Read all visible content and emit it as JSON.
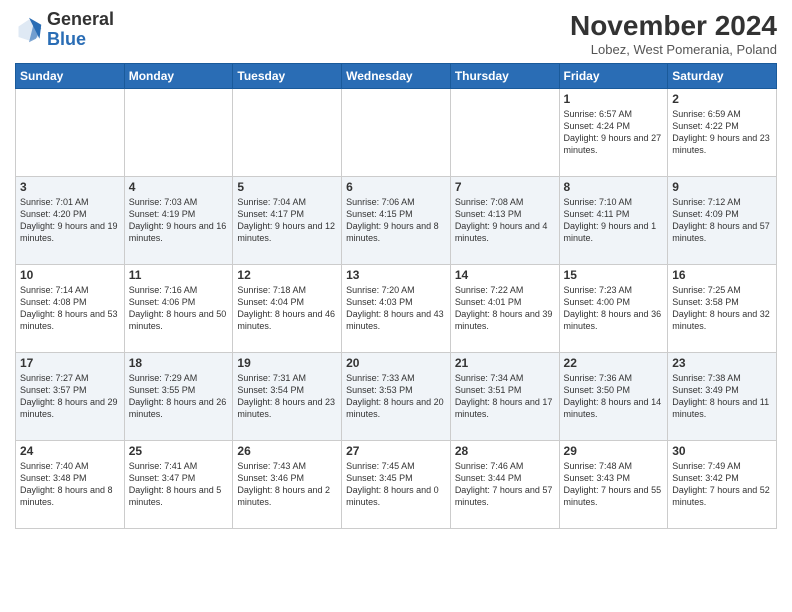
{
  "header": {
    "logo_general": "General",
    "logo_blue": "Blue",
    "month_title": "November 2024",
    "location": "Lobez, West Pomerania, Poland"
  },
  "weekdays": [
    "Sunday",
    "Monday",
    "Tuesday",
    "Wednesday",
    "Thursday",
    "Friday",
    "Saturday"
  ],
  "weeks": [
    [
      {
        "day": "",
        "info": ""
      },
      {
        "day": "",
        "info": ""
      },
      {
        "day": "",
        "info": ""
      },
      {
        "day": "",
        "info": ""
      },
      {
        "day": "",
        "info": ""
      },
      {
        "day": "1",
        "info": "Sunrise: 6:57 AM\nSunset: 4:24 PM\nDaylight: 9 hours\nand 27 minutes."
      },
      {
        "day": "2",
        "info": "Sunrise: 6:59 AM\nSunset: 4:22 PM\nDaylight: 9 hours\nand 23 minutes."
      }
    ],
    [
      {
        "day": "3",
        "info": "Sunrise: 7:01 AM\nSunset: 4:20 PM\nDaylight: 9 hours\nand 19 minutes."
      },
      {
        "day": "4",
        "info": "Sunrise: 7:03 AM\nSunset: 4:19 PM\nDaylight: 9 hours\nand 16 minutes."
      },
      {
        "day": "5",
        "info": "Sunrise: 7:04 AM\nSunset: 4:17 PM\nDaylight: 9 hours\nand 12 minutes."
      },
      {
        "day": "6",
        "info": "Sunrise: 7:06 AM\nSunset: 4:15 PM\nDaylight: 9 hours\nand 8 minutes."
      },
      {
        "day": "7",
        "info": "Sunrise: 7:08 AM\nSunset: 4:13 PM\nDaylight: 9 hours\nand 4 minutes."
      },
      {
        "day": "8",
        "info": "Sunrise: 7:10 AM\nSunset: 4:11 PM\nDaylight: 9 hours\nand 1 minute."
      },
      {
        "day": "9",
        "info": "Sunrise: 7:12 AM\nSunset: 4:09 PM\nDaylight: 8 hours\nand 57 minutes."
      }
    ],
    [
      {
        "day": "10",
        "info": "Sunrise: 7:14 AM\nSunset: 4:08 PM\nDaylight: 8 hours\nand 53 minutes."
      },
      {
        "day": "11",
        "info": "Sunrise: 7:16 AM\nSunset: 4:06 PM\nDaylight: 8 hours\nand 50 minutes."
      },
      {
        "day": "12",
        "info": "Sunrise: 7:18 AM\nSunset: 4:04 PM\nDaylight: 8 hours\nand 46 minutes."
      },
      {
        "day": "13",
        "info": "Sunrise: 7:20 AM\nSunset: 4:03 PM\nDaylight: 8 hours\nand 43 minutes."
      },
      {
        "day": "14",
        "info": "Sunrise: 7:22 AM\nSunset: 4:01 PM\nDaylight: 8 hours\nand 39 minutes."
      },
      {
        "day": "15",
        "info": "Sunrise: 7:23 AM\nSunset: 4:00 PM\nDaylight: 8 hours\nand 36 minutes."
      },
      {
        "day": "16",
        "info": "Sunrise: 7:25 AM\nSunset: 3:58 PM\nDaylight: 8 hours\nand 32 minutes."
      }
    ],
    [
      {
        "day": "17",
        "info": "Sunrise: 7:27 AM\nSunset: 3:57 PM\nDaylight: 8 hours\nand 29 minutes."
      },
      {
        "day": "18",
        "info": "Sunrise: 7:29 AM\nSunset: 3:55 PM\nDaylight: 8 hours\nand 26 minutes."
      },
      {
        "day": "19",
        "info": "Sunrise: 7:31 AM\nSunset: 3:54 PM\nDaylight: 8 hours\nand 23 minutes."
      },
      {
        "day": "20",
        "info": "Sunrise: 7:33 AM\nSunset: 3:53 PM\nDaylight: 8 hours\nand 20 minutes."
      },
      {
        "day": "21",
        "info": "Sunrise: 7:34 AM\nSunset: 3:51 PM\nDaylight: 8 hours\nand 17 minutes."
      },
      {
        "day": "22",
        "info": "Sunrise: 7:36 AM\nSunset: 3:50 PM\nDaylight: 8 hours\nand 14 minutes."
      },
      {
        "day": "23",
        "info": "Sunrise: 7:38 AM\nSunset: 3:49 PM\nDaylight: 8 hours\nand 11 minutes."
      }
    ],
    [
      {
        "day": "24",
        "info": "Sunrise: 7:40 AM\nSunset: 3:48 PM\nDaylight: 8 hours\nand 8 minutes."
      },
      {
        "day": "25",
        "info": "Sunrise: 7:41 AM\nSunset: 3:47 PM\nDaylight: 8 hours\nand 5 minutes."
      },
      {
        "day": "26",
        "info": "Sunrise: 7:43 AM\nSunset: 3:46 PM\nDaylight: 8 hours\nand 2 minutes."
      },
      {
        "day": "27",
        "info": "Sunrise: 7:45 AM\nSunset: 3:45 PM\nDaylight: 8 hours\nand 0 minutes."
      },
      {
        "day": "28",
        "info": "Sunrise: 7:46 AM\nSunset: 3:44 PM\nDaylight: 7 hours\nand 57 minutes."
      },
      {
        "day": "29",
        "info": "Sunrise: 7:48 AM\nSunset: 3:43 PM\nDaylight: 7 hours\nand 55 minutes."
      },
      {
        "day": "30",
        "info": "Sunrise: 7:49 AM\nSunset: 3:42 PM\nDaylight: 7 hours\nand 52 minutes."
      }
    ]
  ]
}
